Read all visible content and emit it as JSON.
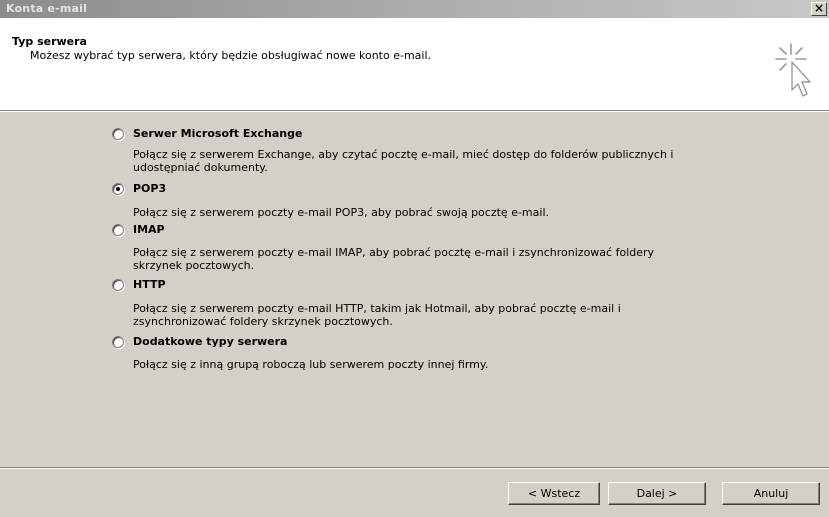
{
  "window": {
    "title": "Konta e-mail",
    "close_glyph": "×"
  },
  "header": {
    "title": "Typ serwera",
    "subtitle": "Możesz wybrać typ serwera, który będzie obsługiwać nowe konto e-mail.",
    "icon": "wizard-cursor-icon"
  },
  "options": [
    {
      "label": "Serwer Microsoft Exchange",
      "description": "Połącz się z serwerem Exchange, aby czytać pocztę e-mail, mieć dostęp do folderów publicznych i udostępniać dokumenty.",
      "selected": false
    },
    {
      "label": "POP3",
      "description": "Połącz się z serwerem poczty e-mail POP3, aby pobrać swoją pocztę e-mail.",
      "selected": true
    },
    {
      "label": "IMAP",
      "description": "Połącz się z serwerem poczty e-mail IMAP, aby pobrać pocztę e-mail i zsynchronizować foldery skrzynek pocztowych.",
      "selected": false
    },
    {
      "label": "HTTP",
      "description": "Połącz się z serwerem poczty e-mail HTTP, takim jak Hotmail, aby pobrać pocztę e-mail i zsynchronizować foldery skrzynek pocztowych.",
      "selected": false
    },
    {
      "label": "Dodatkowe typy serwera",
      "description": "Połącz się z inną grupą roboczą lub serwerem poczty innej firmy.",
      "selected": false
    }
  ],
  "buttons": {
    "back": "< Wstecz",
    "next": "Dalej >",
    "cancel": "Anuluj"
  }
}
